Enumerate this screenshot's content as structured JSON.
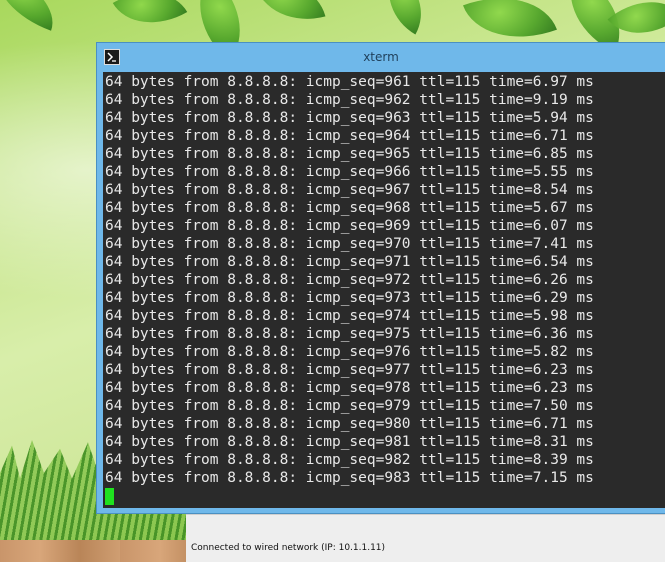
{
  "window": {
    "title": "xterm",
    "icon": "terminal-icon"
  },
  "terminal": {
    "lines": [
      "64 bytes from 8.8.8.8: icmp_seq=961 ttl=115 time=6.97 ms",
      "64 bytes from 8.8.8.8: icmp_seq=962 ttl=115 time=9.19 ms",
      "64 bytes from 8.8.8.8: icmp_seq=963 ttl=115 time=5.94 ms",
      "64 bytes from 8.8.8.8: icmp_seq=964 ttl=115 time=6.71 ms",
      "64 bytes from 8.8.8.8: icmp_seq=965 ttl=115 time=6.85 ms",
      "64 bytes from 8.8.8.8: icmp_seq=966 ttl=115 time=5.55 ms",
      "64 bytes from 8.8.8.8: icmp_seq=967 ttl=115 time=8.54 ms",
      "64 bytes from 8.8.8.8: icmp_seq=968 ttl=115 time=5.67 ms",
      "64 bytes from 8.8.8.8: icmp_seq=969 ttl=115 time=6.07 ms",
      "64 bytes from 8.8.8.8: icmp_seq=970 ttl=115 time=7.41 ms",
      "64 bytes from 8.8.8.8: icmp_seq=971 ttl=115 time=6.54 ms",
      "64 bytes from 8.8.8.8: icmp_seq=972 ttl=115 time=6.26 ms",
      "64 bytes from 8.8.8.8: icmp_seq=973 ttl=115 time=6.29 ms",
      "64 bytes from 8.8.8.8: icmp_seq=974 ttl=115 time=5.98 ms",
      "64 bytes from 8.8.8.8: icmp_seq=975 ttl=115 time=6.36 ms",
      "64 bytes from 8.8.8.8: icmp_seq=976 ttl=115 time=5.82 ms",
      "64 bytes from 8.8.8.8: icmp_seq=977 ttl=115 time=6.23 ms",
      "64 bytes from 8.8.8.8: icmp_seq=978 ttl=115 time=6.23 ms",
      "64 bytes from 8.8.8.8: icmp_seq=979 ttl=115 time=7.50 ms",
      "64 bytes from 8.8.8.8: icmp_seq=980 ttl=115 time=6.71 ms",
      "64 bytes from 8.8.8.8: icmp_seq=981 ttl=115 time=8.31 ms",
      "64 bytes from 8.8.8.8: icmp_seq=982 ttl=115 time=8.39 ms",
      "64 bytes from 8.8.8.8: icmp_seq=983 ttl=115 time=7.15 ms"
    ],
    "cursor_color": "#1fe11f",
    "background": "#2a2a2a",
    "foreground": "#e8e8e8"
  },
  "background_window": {
    "status_text": "Connected to wired network (IP: 10.1.1.11)"
  },
  "colors": {
    "titlebar": "#6fb8ea"
  }
}
